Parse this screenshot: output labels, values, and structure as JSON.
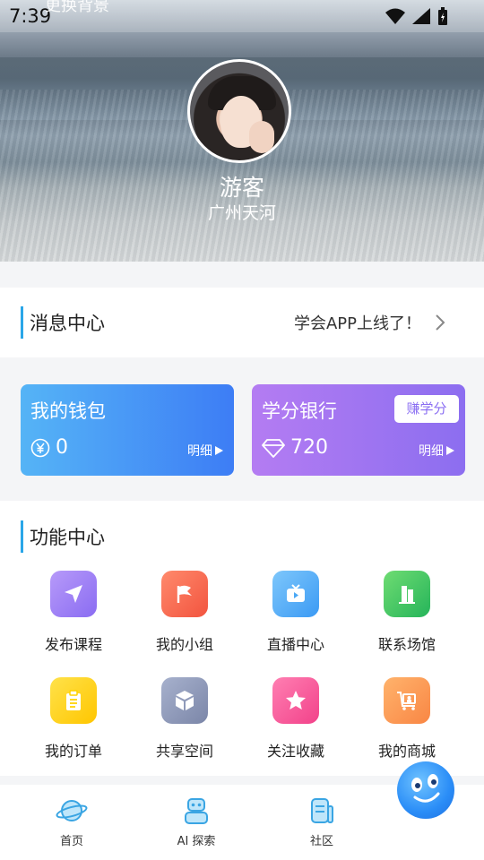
{
  "status": {
    "time": "7:39"
  },
  "header": {
    "change_bg": "更换背景",
    "user_name": "游客",
    "location": "广州天河"
  },
  "message_center": {
    "title": "消息中心",
    "notice": "学会APP上线了！"
  },
  "wallet": {
    "title": "我的钱包",
    "value": "0",
    "detail": "明细"
  },
  "credit_bank": {
    "title": "学分银行",
    "earn_button": "赚学分",
    "value": "720",
    "detail": "明细"
  },
  "functions": {
    "title": "功能中心",
    "items": [
      {
        "label": "发布课程",
        "icon": "send-icon",
        "color": "#9b7bf5"
      },
      {
        "label": "我的小组",
        "icon": "flag-icon",
        "color": "#f56b5a"
      },
      {
        "label": "直播中心",
        "icon": "tv-play-icon",
        "color": "#4aa8f5"
      },
      {
        "label": "联系场馆",
        "icon": "building-icon",
        "color": "#3fc86a"
      },
      {
        "label": "我的订单",
        "icon": "clipboard-icon",
        "color": "#ffd200"
      },
      {
        "label": "共享空间",
        "icon": "cube-icon",
        "color": "#8e99bb"
      },
      {
        "label": "关注收藏",
        "icon": "star-icon",
        "color": "#fb5c9b"
      },
      {
        "label": "我的商城",
        "icon": "cart-icon",
        "color": "#fb9e55"
      }
    ]
  },
  "tabs": [
    {
      "label": "首页",
      "icon": "planet-icon"
    },
    {
      "label": "AI 探索",
      "icon": "robot-icon"
    },
    {
      "label": "社区",
      "icon": "community-icon"
    }
  ],
  "colors": {
    "accent": "#2aa6e8",
    "wallet": "#4a93f5",
    "bank": "#a175f2"
  }
}
